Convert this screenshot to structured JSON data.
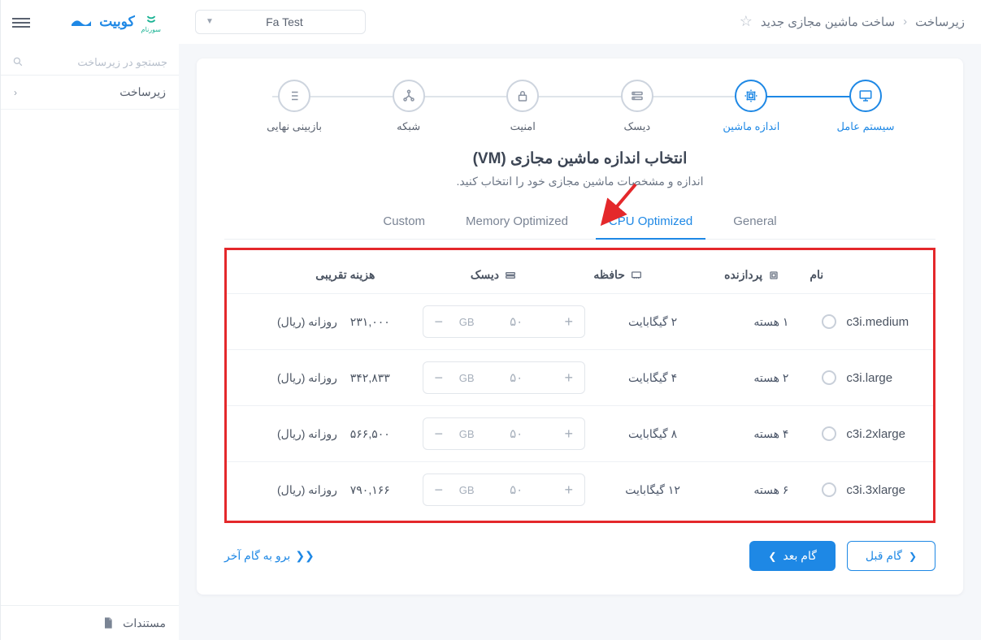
{
  "sidebar": {
    "brand_name": "کوبیت",
    "brand_sub": "سورنام",
    "search_placeholder": "جستجو در زیرساخت",
    "nav_item_infra": "زیرساخت",
    "docs": "مستندات"
  },
  "breadcrumb": {
    "lvl1": "زیرساخت",
    "lvl2": "ساخت ماشین مجازی جدید"
  },
  "dropdown": {
    "selected": "Fa Test"
  },
  "steps": [
    {
      "label": "سیستم عامل"
    },
    {
      "label": "اندازه ماشین"
    },
    {
      "label": "دیسک"
    },
    {
      "label": "امنیت"
    },
    {
      "label": "شبکه"
    },
    {
      "label": "بازبینی نهایی"
    }
  ],
  "section": {
    "title": "انتخاب اندازه ماشین مجازی (VM)",
    "subtitle": "اندازه و مشخصات ماشین مجازی خود را انتخاب کنید."
  },
  "tabs": {
    "general": "General",
    "cpu": "CPU Optimized",
    "memory": "Memory Optimized",
    "custom": "Custom"
  },
  "table": {
    "headers": {
      "name": "نام",
      "cpu": "پردازنده",
      "memory": "حافظه",
      "disk": "دیسک",
      "cost": "هزینه تقریبی"
    },
    "disk_unit": "GB",
    "rows": [
      {
        "name": "c3i.medium",
        "cpu": "۱ هسته",
        "memory": "۲ گیگابایت",
        "disk": "۵۰",
        "cost_num": "۲۳۱,۰۰۰",
        "cost_suffix": "روزانه (ریال)"
      },
      {
        "name": "c3i.large",
        "cpu": "۲ هسته",
        "memory": "۴ گیگابایت",
        "disk": "۵۰",
        "cost_num": "۳۴۲,۸۳۳",
        "cost_suffix": "روزانه (ریال)"
      },
      {
        "name": "c3i.2xlarge",
        "cpu": "۴ هسته",
        "memory": "۸ گیگابایت",
        "disk": "۵۰",
        "cost_num": "۵۶۶,۵۰۰",
        "cost_suffix": "روزانه (ریال)"
      },
      {
        "name": "c3i.3xlarge",
        "cpu": "۶ هسته",
        "memory": "۱۲ گیگابایت",
        "disk": "۵۰",
        "cost_num": "۷۹۰,۱۶۶",
        "cost_suffix": "روزانه (ریال)"
      }
    ]
  },
  "footer": {
    "prev": "گام قبل",
    "next": "گام بعد",
    "skip": "برو به گام آخر"
  }
}
